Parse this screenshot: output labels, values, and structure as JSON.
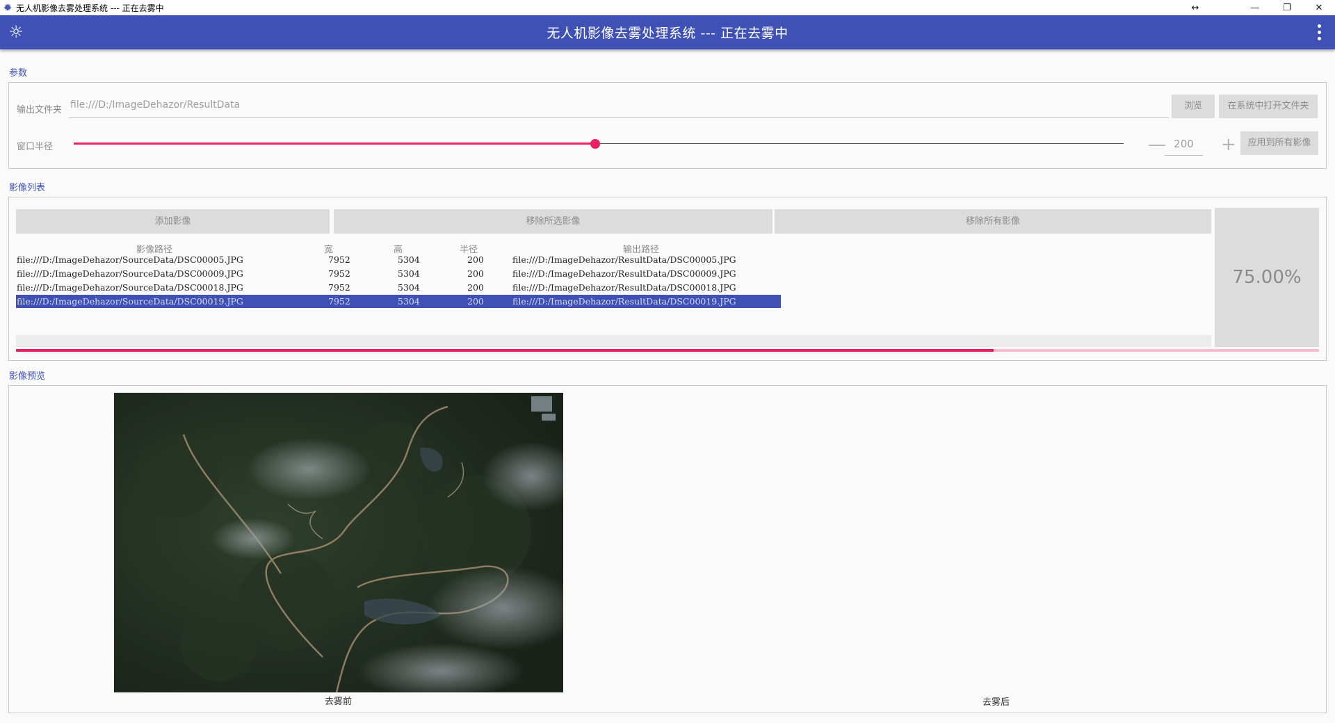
{
  "window": {
    "title": "无人机影像去雾处理系统 --- 正在去雾中",
    "controls": {
      "resize": "↔",
      "minimize": "—",
      "restore": "❐",
      "close": "✕"
    }
  },
  "header": {
    "title": "无人机影像去雾处理系统 --- 正在去雾中",
    "logo_icon": "gear-icon",
    "menu_icon": "more-vert-icon"
  },
  "params": {
    "section_label": "参数",
    "output_folder_label": "输出文件夹",
    "output_folder_value": "file:///D:/ImageDehazor/ResultData",
    "browse_label": "浏览",
    "open_in_system_label": "在系统中打开文件夹",
    "window_radius_label": "窗口半径",
    "radius_value": "200",
    "slider_fraction": 0.5,
    "apply_all_label": "应用到所有影像",
    "minus": "—",
    "plus": "+"
  },
  "image_list": {
    "section_label": "影像列表",
    "add_label": "添加影像",
    "remove_selected_label": "移除所选影像",
    "remove_all_label": "移除所有影像",
    "columns": [
      "影像路径",
      "宽",
      "高",
      "半径",
      "输出路径"
    ],
    "rows": [
      {
        "path": "file:///D:/ImageDehazor/SourceData/DSC00005.JPG",
        "width": "7952",
        "height": "5304",
        "radius": "200",
        "output": "file:///D:/ImageDehazor/ResultData/DSC00005.JPG"
      },
      {
        "path": "file:///D:/ImageDehazor/SourceData/DSC00009.JPG",
        "width": "7952",
        "height": "5304",
        "radius": "200",
        "output": "file:///D:/ImageDehazor/ResultData/DSC00009.JPG"
      },
      {
        "path": "file:///D:/ImageDehazor/SourceData/DSC00018.JPG",
        "width": "7952",
        "height": "5304",
        "radius": "200",
        "output": "file:///D:/ImageDehazor/ResultData/DSC00018.JPG"
      },
      {
        "path": "file:///D:/ImageDehazor/SourceData/DSC00019.JPG",
        "width": "7952",
        "height": "5304",
        "radius": "200",
        "output": "file:///D:/ImageDehazor/ResultData/DSC00019.JPG"
      }
    ],
    "selected_index": 3,
    "progress_text": "75.00%",
    "progress_fraction": 0.75,
    "accent_color": "#e91e63",
    "primary_color": "#3f51b5"
  },
  "preview": {
    "section_label": "影像预览",
    "before_caption": "去雾前",
    "after_caption": "去雾后"
  }
}
